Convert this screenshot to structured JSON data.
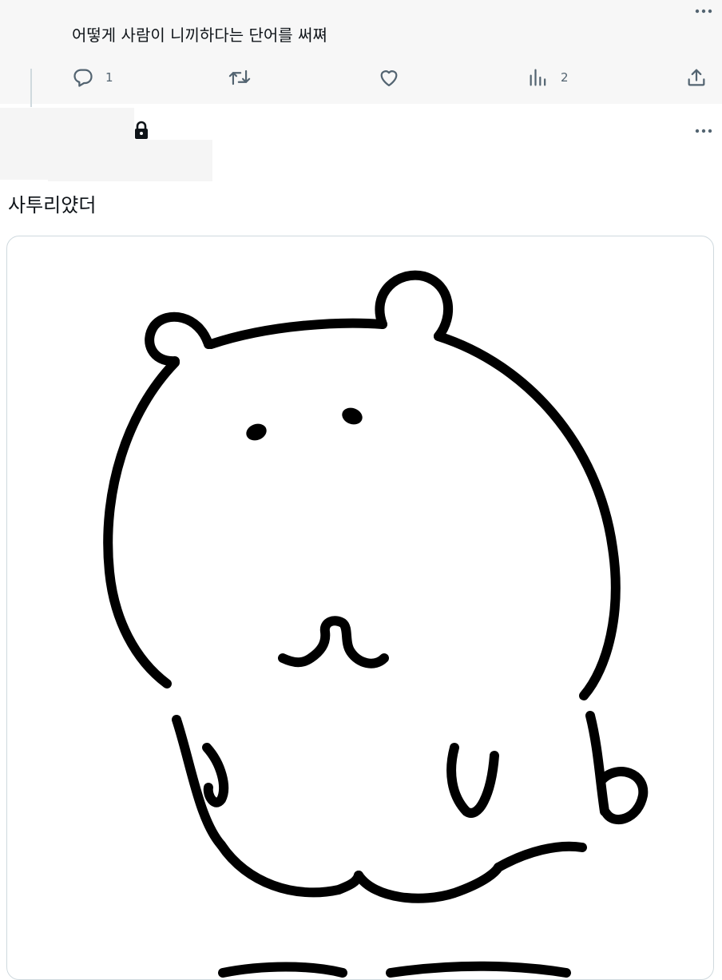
{
  "tweet_1": {
    "text": "어떻게 사람이 니끼하다는 단어를 써쪄",
    "actions": {
      "reply_count": "1",
      "retweet_count": "",
      "like_count": "",
      "views_count": "2"
    }
  },
  "tweet_2": {
    "text": "사투리얐더"
  },
  "icons": {
    "more": "more-horizontal-icon",
    "reply": "reply-icon",
    "retweet": "retweet-icon",
    "like": "heart-icon",
    "views": "views-bar-chart-icon",
    "share": "share-icon",
    "lock": "lock-icon"
  },
  "colors": {
    "text_primary": "#0f1419",
    "text_secondary": "#536471",
    "border": "#cfd9de",
    "top_background": "#f7f7f7"
  }
}
